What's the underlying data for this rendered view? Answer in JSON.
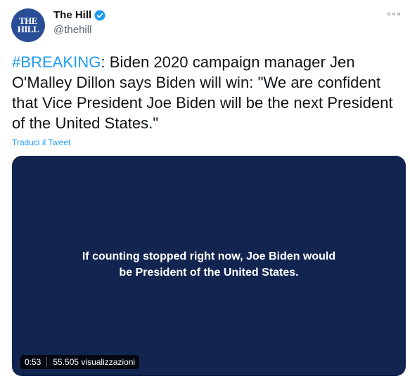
{
  "author": {
    "name": "The Hill",
    "handle": "@thehill",
    "avatar_line1": "THE",
    "avatar_line2": "HILL"
  },
  "tweet": {
    "hashtag": "#BREAKING",
    "text": ": Biden 2020 campaign manager Jen O'Malley Dillon says Biden will win: \"We are confident that Vice President Joe Biden will be the next President of the United States.\"",
    "translate_label": "Traduci il Tweet"
  },
  "media": {
    "caption_line1": "If counting stopped right now, Joe Biden would",
    "caption_line2": "be President of the United States.",
    "duration": "0:53",
    "views": "55.505 visualizzazioni"
  },
  "colors": {
    "accent": "#1d9bf0",
    "video_background": "#122550",
    "avatar_background": "#2a4e96"
  },
  "icons": {
    "verified": "verified-badge-icon",
    "more": "more-options-icon"
  }
}
